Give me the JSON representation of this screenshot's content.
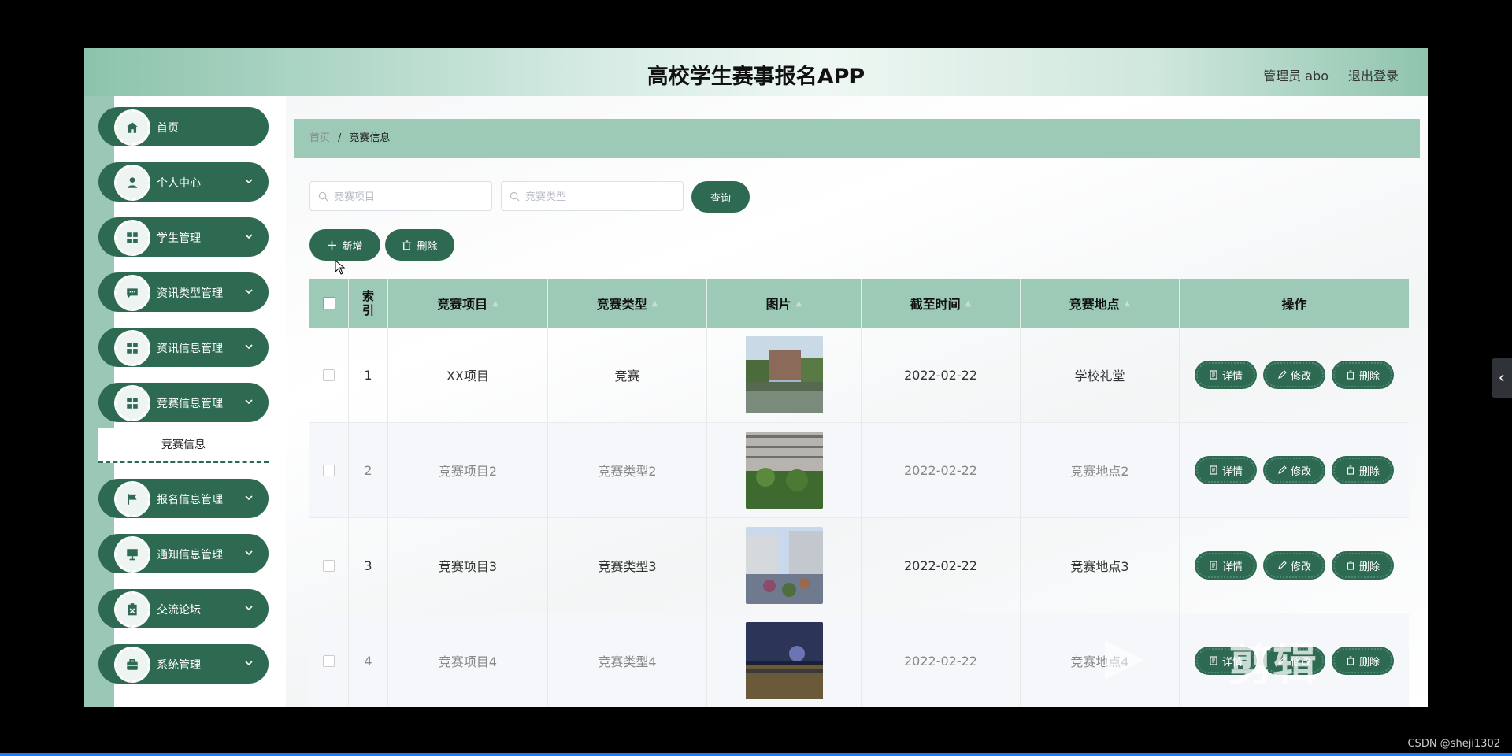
{
  "header": {
    "title": "高校学生赛事报名APP",
    "admin": "管理员 abo",
    "logout": "退出登录"
  },
  "sidebar": {
    "items": [
      {
        "label": "首页",
        "icon": "home-icon"
      },
      {
        "label": "个人中心",
        "icon": "user-icon"
      },
      {
        "label": "学生管理",
        "icon": "grid-icon"
      },
      {
        "label": "资讯类型管理",
        "icon": "message-icon"
      },
      {
        "label": "资讯信息管理",
        "icon": "grid-icon"
      },
      {
        "label": "竞赛信息管理",
        "icon": "grid-icon"
      },
      {
        "label": "报名信息管理",
        "icon": "flag-icon"
      },
      {
        "label": "通知信息管理",
        "icon": "monitor-icon"
      },
      {
        "label": "交流论坛",
        "icon": "clipboard-icon"
      },
      {
        "label": "系统管理",
        "icon": "briefcase-icon"
      }
    ],
    "submenu_label": "竞赛信息"
  },
  "breadcrumb": {
    "home": "首页",
    "separator": "/",
    "current": "竞赛信息"
  },
  "search": {
    "project_placeholder": "竞赛项目",
    "type_placeholder": "竞赛类型",
    "query_label": "查询"
  },
  "actions": {
    "add_label": "新增",
    "delete_label": "删除"
  },
  "table": {
    "headers": [
      "索引",
      "竞赛项目",
      "竞赛类型",
      "图片",
      "截至时间",
      "竞赛地点",
      "操作"
    ],
    "rows": [
      {
        "index": "1",
        "project": "XX项目",
        "type": "竞赛",
        "date": "2022-02-22",
        "location": "学校礼堂"
      },
      {
        "index": "2",
        "project": "竞赛项目2",
        "type": "竞赛类型2",
        "date": "2022-02-22",
        "location": "竞赛地点2"
      },
      {
        "index": "3",
        "project": "竞赛项目3",
        "type": "竞赛类型3",
        "date": "2022-02-22",
        "location": "竞赛地点3"
      },
      {
        "index": "4",
        "project": "竞赛项目4",
        "type": "竞赛类型4",
        "date": "2022-02-22",
        "location": "竞赛地点4"
      }
    ],
    "op_labels": {
      "detail": "详情",
      "edit": "修改",
      "delete": "删除"
    }
  },
  "overlay": {
    "watermark": "剪辑",
    "credit": "CSDN @sheji1302"
  },
  "colors": {
    "primary": "#2e6a52",
    "header_green": "#9ccab7"
  }
}
